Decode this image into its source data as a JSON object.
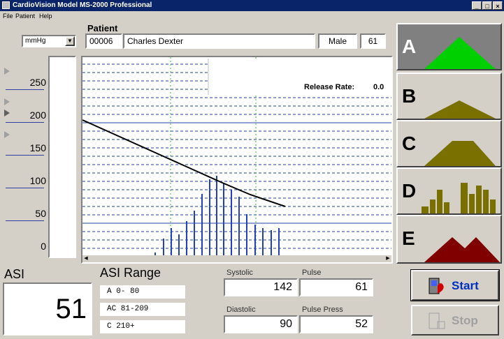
{
  "window": {
    "title": "CardioVision Model MS-2000 Professional",
    "controls": [
      "_",
      "□",
      "×"
    ]
  },
  "menu": [
    "File",
    "Patient",
    "Help"
  ],
  "unit_select": {
    "value": "mmHg"
  },
  "patient": {
    "heading": "Patient",
    "id": "00006",
    "name": "Charles Dexter",
    "sex": "Male",
    "age": "61"
  },
  "scale": {
    "ticks": [
      "250",
      "200",
      "150",
      "100",
      "50",
      "0"
    ]
  },
  "graph": {
    "release_rate_label": "Release Rate:",
    "release_rate_value": "0.0"
  },
  "patterns": [
    {
      "letter": "A",
      "color": "#00d000",
      "selected": true
    },
    {
      "letter": "B",
      "color": "#7a7000",
      "selected": false
    },
    {
      "letter": "C",
      "color": "#7a7000",
      "selected": false
    },
    {
      "letter": "D",
      "color": "#7a7000",
      "selected": false
    },
    {
      "letter": "E",
      "color": "#800000",
      "selected": false
    }
  ],
  "asi": {
    "label": "ASI",
    "value": "51"
  },
  "asi_range": {
    "label": "ASI Range",
    "rows": [
      "A        0-  80",
      "AC    81-209",
      "C     210+"
    ]
  },
  "readings": {
    "systolic": {
      "label": "Systolic",
      "value": "142"
    },
    "pulse": {
      "label": "Pulse",
      "value": "61"
    },
    "diastolic": {
      "label": "Diastolic",
      "value": "90"
    },
    "pulse_press": {
      "label": "Pulse Press",
      "value": "52"
    }
  },
  "buttons": {
    "start": "Start",
    "stop": "Stop"
  },
  "colors": {
    "title_bar": "#0a246a",
    "oscillation": "#2040c0",
    "pressure_curve": "#000000"
  }
}
